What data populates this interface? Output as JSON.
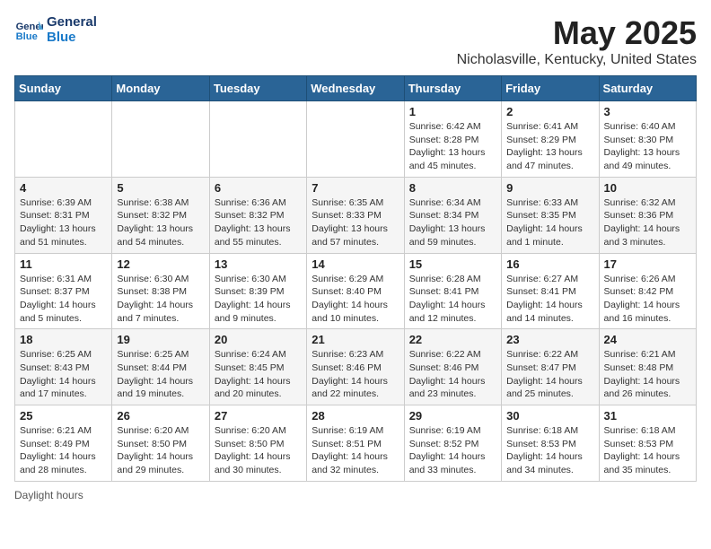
{
  "logo": {
    "line1": "General",
    "line2": "Blue"
  },
  "title": "May 2025",
  "location": "Nicholasville, Kentucky, United States",
  "footer": "Daylight hours",
  "weekdays": [
    "Sunday",
    "Monday",
    "Tuesday",
    "Wednesday",
    "Thursday",
    "Friday",
    "Saturday"
  ],
  "weeks": [
    [
      {
        "num": "",
        "info": ""
      },
      {
        "num": "",
        "info": ""
      },
      {
        "num": "",
        "info": ""
      },
      {
        "num": "",
        "info": ""
      },
      {
        "num": "1",
        "info": "Sunrise: 6:42 AM\nSunset: 8:28 PM\nDaylight: 13 hours and 45 minutes."
      },
      {
        "num": "2",
        "info": "Sunrise: 6:41 AM\nSunset: 8:29 PM\nDaylight: 13 hours and 47 minutes."
      },
      {
        "num": "3",
        "info": "Sunrise: 6:40 AM\nSunset: 8:30 PM\nDaylight: 13 hours and 49 minutes."
      }
    ],
    [
      {
        "num": "4",
        "info": "Sunrise: 6:39 AM\nSunset: 8:31 PM\nDaylight: 13 hours and 51 minutes."
      },
      {
        "num": "5",
        "info": "Sunrise: 6:38 AM\nSunset: 8:32 PM\nDaylight: 13 hours and 54 minutes."
      },
      {
        "num": "6",
        "info": "Sunrise: 6:36 AM\nSunset: 8:32 PM\nDaylight: 13 hours and 55 minutes."
      },
      {
        "num": "7",
        "info": "Sunrise: 6:35 AM\nSunset: 8:33 PM\nDaylight: 13 hours and 57 minutes."
      },
      {
        "num": "8",
        "info": "Sunrise: 6:34 AM\nSunset: 8:34 PM\nDaylight: 13 hours and 59 minutes."
      },
      {
        "num": "9",
        "info": "Sunrise: 6:33 AM\nSunset: 8:35 PM\nDaylight: 14 hours and 1 minute."
      },
      {
        "num": "10",
        "info": "Sunrise: 6:32 AM\nSunset: 8:36 PM\nDaylight: 14 hours and 3 minutes."
      }
    ],
    [
      {
        "num": "11",
        "info": "Sunrise: 6:31 AM\nSunset: 8:37 PM\nDaylight: 14 hours and 5 minutes."
      },
      {
        "num": "12",
        "info": "Sunrise: 6:30 AM\nSunset: 8:38 PM\nDaylight: 14 hours and 7 minutes."
      },
      {
        "num": "13",
        "info": "Sunrise: 6:30 AM\nSunset: 8:39 PM\nDaylight: 14 hours and 9 minutes."
      },
      {
        "num": "14",
        "info": "Sunrise: 6:29 AM\nSunset: 8:40 PM\nDaylight: 14 hours and 10 minutes."
      },
      {
        "num": "15",
        "info": "Sunrise: 6:28 AM\nSunset: 8:41 PM\nDaylight: 14 hours and 12 minutes."
      },
      {
        "num": "16",
        "info": "Sunrise: 6:27 AM\nSunset: 8:41 PM\nDaylight: 14 hours and 14 minutes."
      },
      {
        "num": "17",
        "info": "Sunrise: 6:26 AM\nSunset: 8:42 PM\nDaylight: 14 hours and 16 minutes."
      }
    ],
    [
      {
        "num": "18",
        "info": "Sunrise: 6:25 AM\nSunset: 8:43 PM\nDaylight: 14 hours and 17 minutes."
      },
      {
        "num": "19",
        "info": "Sunrise: 6:25 AM\nSunset: 8:44 PM\nDaylight: 14 hours and 19 minutes."
      },
      {
        "num": "20",
        "info": "Sunrise: 6:24 AM\nSunset: 8:45 PM\nDaylight: 14 hours and 20 minutes."
      },
      {
        "num": "21",
        "info": "Sunrise: 6:23 AM\nSunset: 8:46 PM\nDaylight: 14 hours and 22 minutes."
      },
      {
        "num": "22",
        "info": "Sunrise: 6:22 AM\nSunset: 8:46 PM\nDaylight: 14 hours and 23 minutes."
      },
      {
        "num": "23",
        "info": "Sunrise: 6:22 AM\nSunset: 8:47 PM\nDaylight: 14 hours and 25 minutes."
      },
      {
        "num": "24",
        "info": "Sunrise: 6:21 AM\nSunset: 8:48 PM\nDaylight: 14 hours and 26 minutes."
      }
    ],
    [
      {
        "num": "25",
        "info": "Sunrise: 6:21 AM\nSunset: 8:49 PM\nDaylight: 14 hours and 28 minutes."
      },
      {
        "num": "26",
        "info": "Sunrise: 6:20 AM\nSunset: 8:50 PM\nDaylight: 14 hours and 29 minutes."
      },
      {
        "num": "27",
        "info": "Sunrise: 6:20 AM\nSunset: 8:50 PM\nDaylight: 14 hours and 30 minutes."
      },
      {
        "num": "28",
        "info": "Sunrise: 6:19 AM\nSunset: 8:51 PM\nDaylight: 14 hours and 32 minutes."
      },
      {
        "num": "29",
        "info": "Sunrise: 6:19 AM\nSunset: 8:52 PM\nDaylight: 14 hours and 33 minutes."
      },
      {
        "num": "30",
        "info": "Sunrise: 6:18 AM\nSunset: 8:53 PM\nDaylight: 14 hours and 34 minutes."
      },
      {
        "num": "31",
        "info": "Sunrise: 6:18 AM\nSunset: 8:53 PM\nDaylight: 14 hours and 35 minutes."
      }
    ]
  ]
}
